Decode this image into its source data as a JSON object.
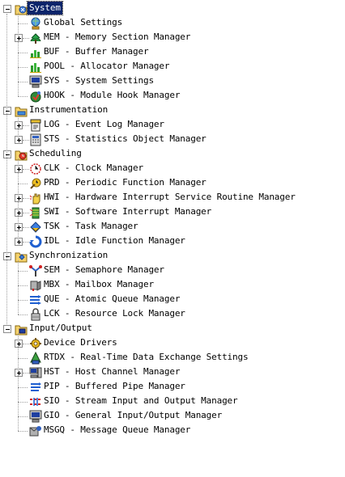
{
  "tree": {
    "groups": [
      {
        "label": "System",
        "icon": "system-folder-icon",
        "expanded": true,
        "selected": true,
        "children": [
          {
            "label": "Global Settings",
            "icon": "globe-settings-icon",
            "expandable": false
          },
          {
            "label": "MEM - Memory Section Manager",
            "icon": "memory-icon",
            "expandable": true
          },
          {
            "label": "BUF - Buffer Manager",
            "icon": "buffer-icon",
            "expandable": false
          },
          {
            "label": "POOL - Allocator Manager",
            "icon": "pool-icon",
            "expandable": false
          },
          {
            "label": "SYS - System Settings",
            "icon": "monitor-icon",
            "expandable": false
          },
          {
            "label": "HOOK - Module Hook Manager",
            "icon": "hook-icon",
            "expandable": false
          }
        ]
      },
      {
        "label": "Instrumentation",
        "icon": "instrumentation-folder-icon",
        "expanded": true,
        "selected": false,
        "children": [
          {
            "label": "LOG - Event Log Manager",
            "icon": "log-icon",
            "expandable": true
          },
          {
            "label": "STS - Statistics Object Manager",
            "icon": "statistics-icon",
            "expandable": true
          }
        ]
      },
      {
        "label": "Scheduling",
        "icon": "scheduling-folder-icon",
        "expanded": true,
        "selected": false,
        "children": [
          {
            "label": "CLK - Clock Manager",
            "icon": "clock-icon",
            "expandable": true
          },
          {
            "label": "PRD - Periodic Function Manager",
            "icon": "periodic-icon",
            "expandable": false
          },
          {
            "label": "HWI - Hardware Interrupt Service Routine Manager",
            "icon": "hand-interrupt-icon",
            "expandable": true
          },
          {
            "label": "SWI - Software Interrupt Manager",
            "icon": "software-interrupt-icon",
            "expandable": true
          },
          {
            "label": "TSK - Task Manager",
            "icon": "task-icon",
            "expandable": true
          },
          {
            "label": "IDL - Idle Function Manager",
            "icon": "idle-cycle-icon",
            "expandable": true
          }
        ]
      },
      {
        "label": "Synchronization",
        "icon": "synchronization-folder-icon",
        "expanded": true,
        "selected": false,
        "children": [
          {
            "label": "SEM - Semaphore Manager",
            "icon": "semaphore-icon",
            "expandable": false
          },
          {
            "label": "MBX - Mailbox Manager",
            "icon": "mailbox-icon",
            "expandable": false
          },
          {
            "label": "QUE - Atomic Queue Manager",
            "icon": "queue-icon",
            "expandable": false
          },
          {
            "label": "LCK - Resource Lock Manager",
            "icon": "lock-icon",
            "expandable": false
          }
        ]
      },
      {
        "label": "Input/Output",
        "icon": "io-folder-icon",
        "expanded": true,
        "selected": false,
        "children": [
          {
            "label": "Device Drivers",
            "icon": "device-drivers-icon",
            "expandable": true
          },
          {
            "label": "RTDX - Real-Time Data Exchange Settings",
            "icon": "rtdx-icon",
            "expandable": false
          },
          {
            "label": "HST - Host Channel Manager",
            "icon": "host-channel-icon",
            "expandable": true
          },
          {
            "label": "PIP - Buffered Pipe Manager",
            "icon": "pipe-icon",
            "expandable": false
          },
          {
            "label": "SIO - Stream Input and Output Manager",
            "icon": "stream-io-icon",
            "expandable": false
          },
          {
            "label": "GIO - General Input/Output Manager",
            "icon": "gio-monitor-icon",
            "expandable": false
          },
          {
            "label": "MSGQ - Message Queue Manager",
            "icon": "message-queue-icon",
            "expandable": false
          }
        ]
      }
    ]
  }
}
